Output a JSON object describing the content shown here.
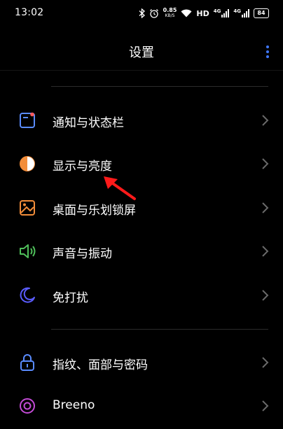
{
  "status_bar": {
    "time": "13:02",
    "speed_value": "0.85",
    "speed_unit": "KB/S",
    "hd": "HD",
    "net1": "4G",
    "net2": "4G",
    "battery": "84",
    "icons": [
      "bluetooth-icon",
      "alarm-icon",
      "wifi-icon",
      "signal-icon",
      "battery-icon"
    ]
  },
  "header": {
    "title": "设置",
    "menu_icon": "more-vertical-icon"
  },
  "settings": {
    "items": [
      {
        "label": "通知与状态栏",
        "icon": "notification-statusbar-icon",
        "color": "#5a8cff"
      },
      {
        "label": "显示与亮度",
        "icon": "display-brightness-icon",
        "color": "#f28d3a"
      },
      {
        "label": "桌面与乐划锁屏",
        "icon": "wallpaper-lockscreen-icon",
        "color": "#f28d3a"
      },
      {
        "label": "声音与振动",
        "icon": "sound-vibration-icon",
        "color": "#4fbf5a"
      },
      {
        "label": "免打扰",
        "icon": "do-not-disturb-icon",
        "color": "#5a5cff"
      },
      {
        "label": "指纹、面部与密码",
        "icon": "fingerprint-lock-icon",
        "color": "#5a8cff"
      },
      {
        "label": "Breeno",
        "icon": "breeno-icon",
        "color": "#c34bd6"
      }
    ]
  },
  "colors": {
    "background": "#000000",
    "accent": "#3f78ff",
    "annotation": "#ff1a1a",
    "chevron": "#6a6a6a"
  }
}
